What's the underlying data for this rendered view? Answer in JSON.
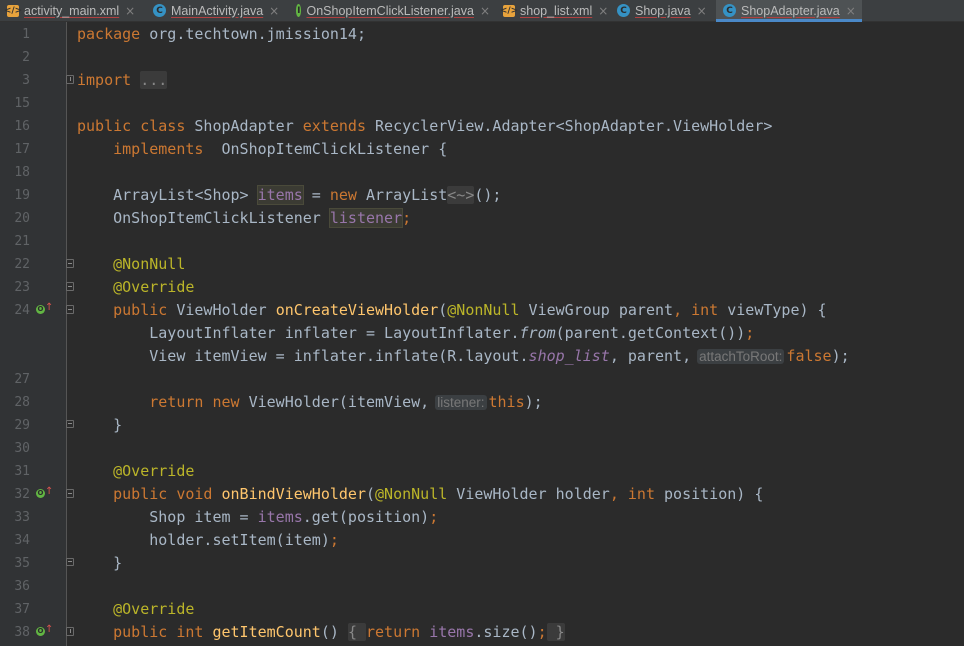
{
  "tabs": [
    {
      "label": "activity_main.xml",
      "icon": "xml-file-icon"
    },
    {
      "label": "MainActivity.java",
      "icon": "java-class-icon"
    },
    {
      "label": "OnShopItemClickListener.java",
      "icon": "java-interface-icon"
    },
    {
      "label": "shop_list.xml",
      "icon": "xml-file-icon"
    },
    {
      "label": "Shop.java",
      "icon": "java-class-icon"
    },
    {
      "label": "ShopAdapter.java",
      "icon": "java-class-icon",
      "active": true
    }
  ],
  "tab_close_glyph": "×",
  "editor": {
    "line_numbers": [
      "1",
      "2",
      "3",
      "15",
      "16",
      "17",
      "18",
      "19",
      "20",
      "21",
      "22",
      "23",
      "24",
      "27",
      "28",
      "29",
      "30",
      "31",
      "32",
      "33",
      "34",
      "35",
      "36",
      "37",
      "38"
    ],
    "l1": {
      "kw": "package",
      "rest": " org.techtown.jmission14;"
    },
    "l3": {
      "kw": "import",
      "fold": "..."
    },
    "l16": {
      "k1": "public class",
      "name": " ShopAdapter ",
      "k2": "extends",
      "rest": " RecyclerView.Adapter<ShopAdapter.ViewHolder>"
    },
    "l17": {
      "kw": "implements",
      "rest": "  OnShopItemClickListener {"
    },
    "l19": {
      "a": "ArrayList<Shop> ",
      "field": "items",
      "b": " = ",
      "kw": "new",
      "c": " ArrayList",
      "diamond": "<~>",
      "d": "();"
    },
    "l20": {
      "a": "OnShopItemClickListener ",
      "field": "listener",
      "semi": ";"
    },
    "l22": {
      "ann": "@NonNull"
    },
    "l23": {
      "ann": "@Override"
    },
    "l24": {
      "kw": "public",
      "a": " ViewHolder ",
      "fn": "onCreateViewHolder",
      "p": "(",
      "ann": "@NonNull",
      "b": " ViewGroup parent",
      "c": ", ",
      "kw2": "int",
      "d": " viewType) {"
    },
    "l25": {
      "a": "LayoutInflater inflater = LayoutInflater.",
      "it": "from",
      "b": "(parent.getContext())",
      "semi": ";"
    },
    "l26": {
      "a": "View itemView = inflater.inflate(R.layout.",
      "st": "shop_list",
      "b": ", parent,",
      "hint": "attachToRoot:",
      "kw": "false",
      "c": ");"
    },
    "l28": {
      "kw": "return",
      "kw2": " new",
      "a": " ViewHolder(itemView,",
      "hint": "listener:",
      "kw3": "this",
      "c": ");"
    },
    "l29": {
      "a": "}"
    },
    "l31": {
      "ann": "@Override"
    },
    "l32": {
      "kw": "public void",
      "fn": " onBindViewHolder",
      "p": "(",
      "ann": "@NonNull",
      "b": " ViewHolder holder",
      "c": ", ",
      "kw2": "int",
      "d": " position) {"
    },
    "l33": {
      "a": "Shop item = ",
      "field": "items",
      "b": ".get(position)",
      "semi": ";"
    },
    "l34": {
      "a": "holder.setItem(item)",
      "semi": ";"
    },
    "l35": {
      "a": "}"
    },
    "l37": {
      "ann": "@Override"
    },
    "l38": {
      "kw": "public int",
      "fn": " getItemCount",
      "p": "() ",
      "fo": "{ ",
      "kw2": "return",
      "sp": " ",
      "field": "items",
      "b": ".size()",
      "semi": ";",
      "fc": " }"
    }
  },
  "colors": {
    "background": "#2b2b2b",
    "keyword": "#cc7832",
    "annotation": "#bbb529",
    "method": "#ffc66d",
    "field": "#9876aa",
    "text": "#a9b7c6",
    "active_tab_accent": "#4a88c7"
  }
}
